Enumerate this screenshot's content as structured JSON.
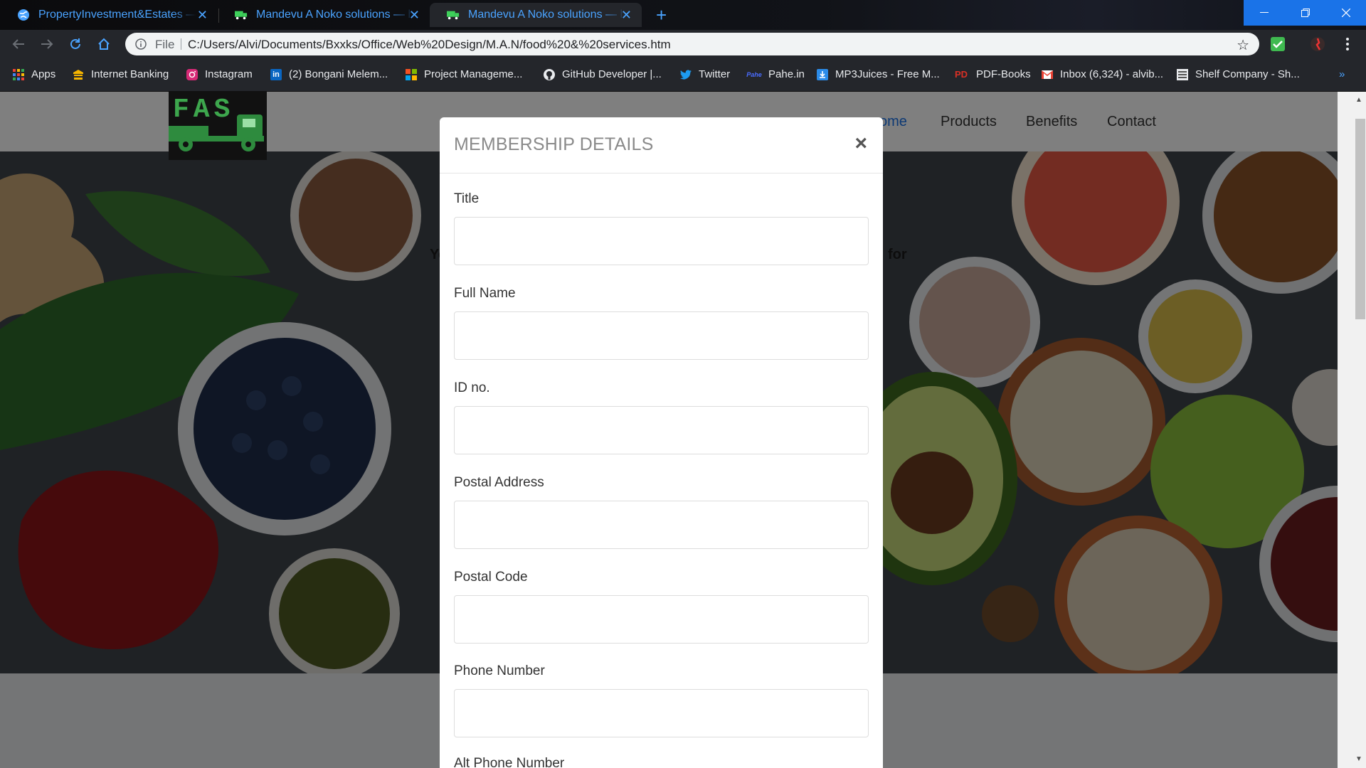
{
  "browser": {
    "tabs": [
      {
        "title": "PropertyInvestment&Estates — ht",
        "active": false
      },
      {
        "title": "Mandevu A Noko solutions — ht",
        "active": false
      },
      {
        "title": "Mandevu A Noko solutions — ht",
        "active": true
      }
    ],
    "address": {
      "scheme_label": "File",
      "url": "C:/Users/Alvi/Documents/Bxxks/Office/Web%20Design/M.A.N/food%20&%20services.htm"
    },
    "bookmarks": [
      {
        "label": "Apps",
        "icon": "apps-grid-icon"
      },
      {
        "label": "Internet Banking",
        "icon": "bank-icon"
      },
      {
        "label": "Instagram",
        "icon": "instagram-icon"
      },
      {
        "label": "(2) Bongani Melem...",
        "icon": "linkedin-icon"
      },
      {
        "label": "Project Manageme...",
        "icon": "microsoft-icon"
      },
      {
        "label": "GitHub Developer |...",
        "icon": "github-icon"
      },
      {
        "label": "Twitter",
        "icon": "twitter-icon"
      },
      {
        "label": "Pahe.in",
        "icon": "pahe-icon"
      },
      {
        "label": "MP3Juices - Free M...",
        "icon": "download-icon"
      },
      {
        "label": "PDF-Books",
        "icon": "pdf-icon"
      },
      {
        "label": "Inbox (6,324) - alvib...",
        "icon": "gmail-icon"
      },
      {
        "label": "Shelf Company - Sh...",
        "icon": "shelf-icon"
      }
    ],
    "overflow_label": "»"
  },
  "site": {
    "logo_text": "FAS",
    "nav": [
      {
        "label": "ome"
      },
      {
        "label": "Products"
      },
      {
        "label": "Benefits"
      },
      {
        "label": "Contact"
      }
    ],
    "hero_fragments": {
      "left": "Yo",
      "right": "for"
    }
  },
  "modal": {
    "title": "MEMBERSHIP DETAILS",
    "close_symbol": "×",
    "fields": [
      {
        "label": "Title",
        "value": ""
      },
      {
        "label": "Full Name",
        "value": ""
      },
      {
        "label": "ID no.",
        "value": ""
      },
      {
        "label": "Postal Address",
        "value": ""
      },
      {
        "label": "Postal Code",
        "value": ""
      },
      {
        "label": "Phone Number",
        "value": ""
      },
      {
        "label": "Alt Phone Number",
        "value": ""
      }
    ]
  },
  "colors": {
    "accent_blue": "#4aa3ff",
    "logo_green": "#2e8b3e"
  }
}
